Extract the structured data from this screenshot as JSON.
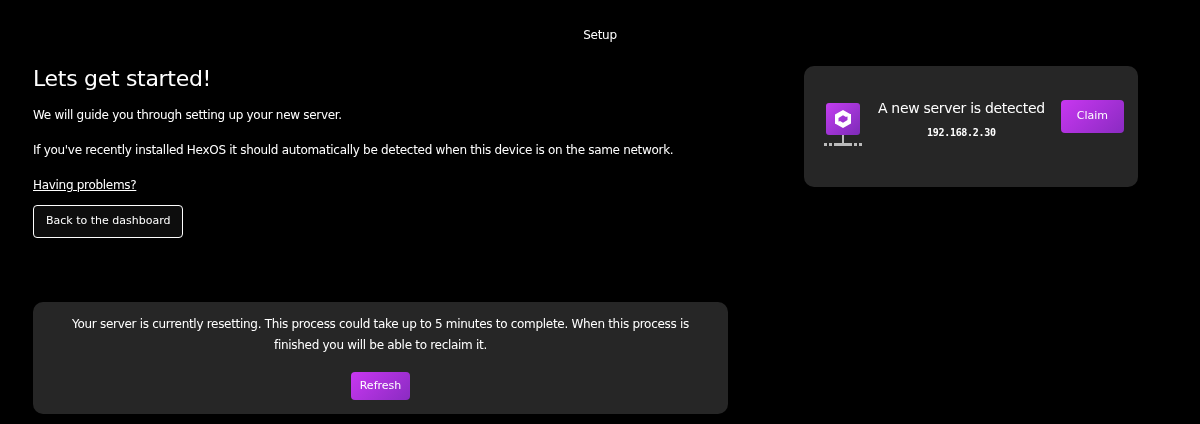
{
  "header": {
    "title": "Setup"
  },
  "intro": {
    "heading": "Lets get started!",
    "paragraphs": [
      "We will guide you through setting up your new server.",
      "If you've recently installed HexOS it should automatically be detected when this device is on the same network."
    ],
    "help_link": "Having problems?",
    "back_button": "Back to the dashboard"
  },
  "detected_server": {
    "title": "A new server is detected",
    "ip": "192.168.2.30",
    "button": "Claim"
  },
  "reset_notice": {
    "message": "Your server is currently resetting. This process could take up to 5 minutes to complete. When this process is finished you will be able to reclaim it.",
    "button": "Refresh"
  }
}
